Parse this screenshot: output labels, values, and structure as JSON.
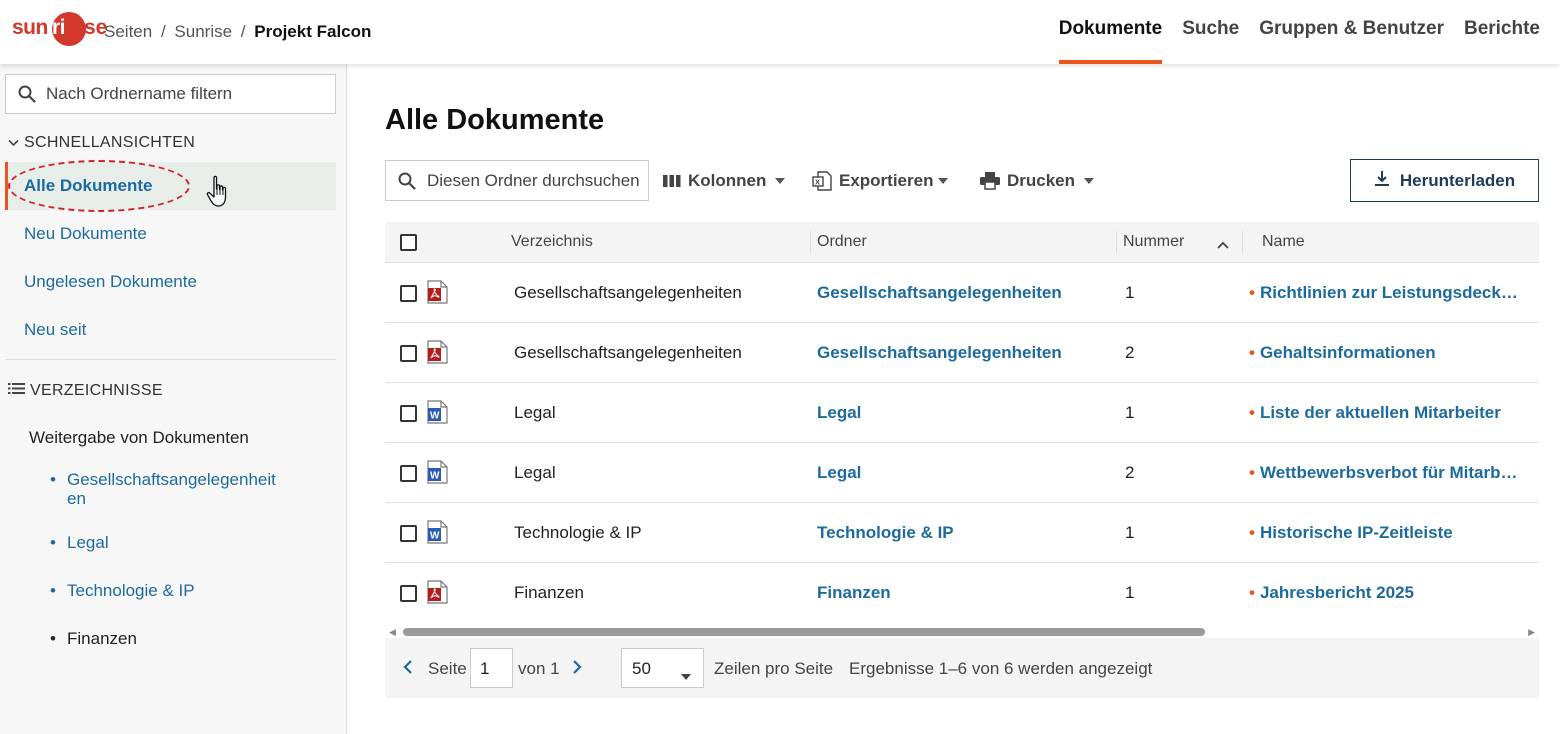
{
  "brand": {
    "logo_part1": "sun",
    "logo_part2": "ri",
    "logo_part3": "se"
  },
  "breadcrumb": {
    "root": "Seiten",
    "parent": "Sunrise",
    "current": "Projekt Falcon",
    "separator": "/"
  },
  "topnav": [
    {
      "label": "Dokumente",
      "active": true
    },
    {
      "label": "Suche"
    },
    {
      "label": "Gruppen & Benutzer"
    },
    {
      "label": "Berichte"
    }
  ],
  "sidebar": {
    "filter_placeholder": "Nach Ordnername filtern",
    "quickviews_title": "SCHNELLANSICHTEN",
    "quickviews": [
      {
        "label": "Alle Dokumente",
        "active": true
      },
      {
        "label": "Neu Dokumente"
      },
      {
        "label": "Ungelesen Dokumente"
      },
      {
        "label": "Neu seit"
      }
    ],
    "directories_title": "VERZEICHNISSE",
    "tree_root": "Weitergabe von Dokumenten",
    "tree_items": [
      {
        "label": "Gesellschaftsangelegenheit\nen"
      },
      {
        "label": "Legal"
      },
      {
        "label": "Technologie & IP"
      },
      {
        "label": "Finanzen"
      }
    ]
  },
  "main": {
    "title": "Alle Dokumente",
    "search_placeholder": "Diesen Ordner durchsuchen",
    "toolbar": {
      "columns": "Kolonnen",
      "export": "Exportieren",
      "print": "Drucken",
      "download": "Herunterladen"
    },
    "table": {
      "headers": {
        "directory": "Verzeichnis",
        "folder": "Ordner",
        "number": "Nummer",
        "name": "Name"
      },
      "rows": [
        {
          "type": "pdf",
          "directory": "Gesellschaftsangelegenheiten",
          "folder": "Gesellschaftsangelegenheiten",
          "number": "1",
          "name": "Richtlinien zur Leistungsdeckung"
        },
        {
          "type": "pdf",
          "directory": "Gesellschaftsangelegenheiten",
          "folder": "Gesellschaftsangelegenheiten",
          "number": "2",
          "name": "Gehaltsinformationen"
        },
        {
          "type": "word",
          "directory": "Legal",
          "folder": "Legal",
          "number": "1",
          "name": "Liste der aktuellen Mitarbeiter"
        },
        {
          "type": "word",
          "directory": "Legal",
          "folder": "Legal",
          "number": "2",
          "name": "Wettbewerbsverbot für Mitarbeiter"
        },
        {
          "type": "word",
          "directory": "Technologie & IP",
          "folder": "Technologie & IP",
          "number": "1",
          "name": "Historische IP-Zeitleiste"
        },
        {
          "type": "pdf",
          "directory": "Finanzen",
          "folder": "Finanzen",
          "number": "1",
          "name": "Jahresbericht 2025"
        }
      ]
    },
    "pager": {
      "page_label": "Seite",
      "page_value": "1",
      "of_label": "von 1",
      "page_size": "50",
      "rows_per_page": "Zeilen pro Seite",
      "results": "Ergebnisse 1–6 von 6 werden angezeigt"
    }
  },
  "colors": {
    "accent": "#e8561e",
    "link": "#1d6a9e",
    "brand": "#d2382b",
    "annotation": "#d2232a"
  }
}
